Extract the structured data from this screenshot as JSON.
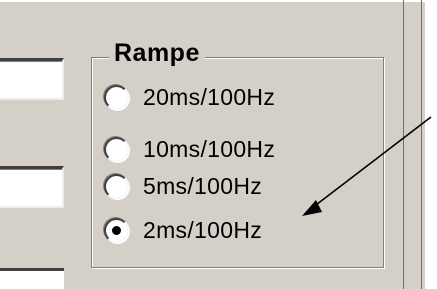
{
  "group": {
    "title": "Rampe"
  },
  "options": [
    {
      "label": "20ms/100Hz",
      "checked": false
    },
    {
      "label": "10ms/100Hz",
      "checked": false
    },
    {
      "label": "5ms/100Hz",
      "checked": false
    },
    {
      "label": "2ms/100Hz",
      "checked": true
    }
  ]
}
